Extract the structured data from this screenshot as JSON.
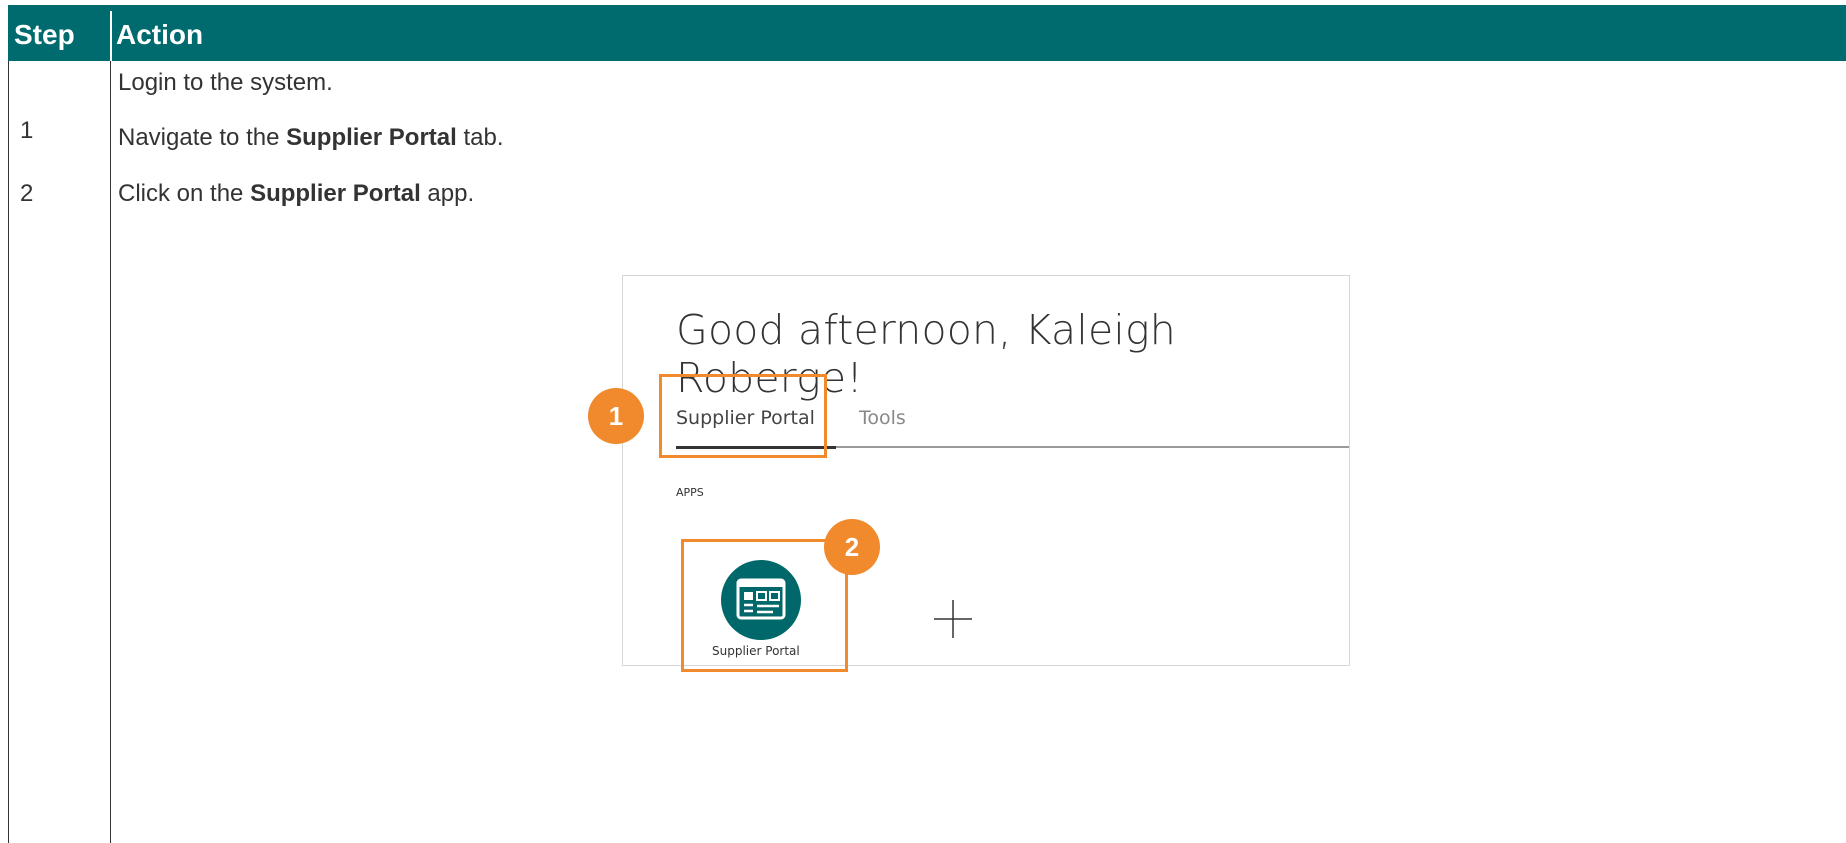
{
  "header": {
    "step_label": "Step",
    "action_label": "Action"
  },
  "rows": [
    {
      "step": "",
      "text": "Login to the system."
    },
    {
      "step": "1",
      "text_before": "Navigate to the ",
      "bold": "Supplier Portal",
      "text_after": " tab."
    },
    {
      "step": "2",
      "text_before": "Click on the ",
      "bold": "Supplier Portal",
      "text_after": " app."
    }
  ],
  "screenshot": {
    "greeting": "Good afternoon, Kaleigh Roberge!",
    "tabs": [
      {
        "label": "Supplier Portal",
        "active": true
      },
      {
        "label": "Tools",
        "active": false
      }
    ],
    "section_label": "APPS",
    "app": {
      "label": "Supplier Portal",
      "icon": "supplier-portal-app-icon"
    },
    "add_icon": "plus-icon"
  },
  "callouts": [
    {
      "number": "1"
    },
    {
      "number": "2"
    }
  ],
  "colors": {
    "header_bg": "#006b6e",
    "callout": "#f08a2c",
    "app_tile": "#00686b"
  }
}
